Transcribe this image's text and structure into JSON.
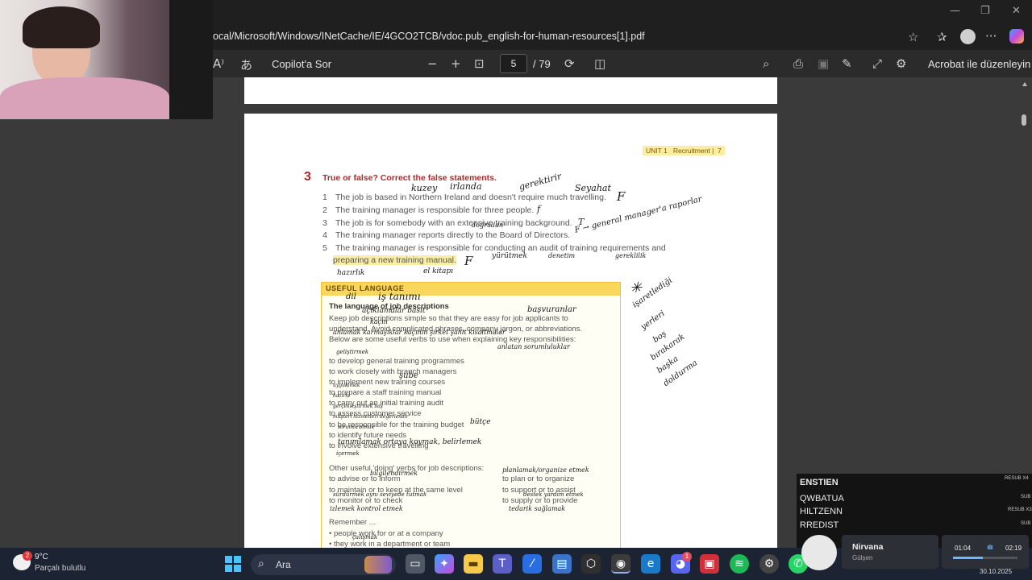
{
  "browser": {
    "address": "ocal/Microsoft/Windows/INetCache/IE/4GCO2TCB/vdoc.pub_english-for-human-resources[1].pdf",
    "window_controls": [
      "—",
      "❐",
      "✕"
    ]
  },
  "pdf_toolbar": {
    "copilot_label": "Copilot'a Sor",
    "page_current": "5",
    "page_total": "/ 79",
    "acrobat_label": "Acrobat ile düzenleyin"
  },
  "document": {
    "header_unit": "UNIT 1",
    "header_section": "Recruitment",
    "header_page": "7",
    "exercise_number": "3",
    "exercise_title": "True or false? Correct the false statements.",
    "statements": [
      {
        "num": "1",
        "text": "The job is based in Northern Ireland and doesn't require much travelling."
      },
      {
        "num": "2",
        "text": "The training manager is responsible for three people."
      },
      {
        "num": "3",
        "text": "The job is for somebody with an extensive training background."
      },
      {
        "num": "4",
        "text": "The training manager reports directly to the Board of Directors."
      },
      {
        "num": "5",
        "text": "The training manager is responsible for conducting an audit of training requirements and"
      },
      {
        "num": "",
        "text": "preparing a new training manual."
      }
    ],
    "useful_language": {
      "heading": "USEFUL LANGUAGE",
      "subheading": "The language of job descriptions",
      "intro": [
        "Keep job descriptions simple so that they are easy for job applicants to",
        "understand. Avoid complicated phrases, company jargon, or abbreviations.",
        "Below are some useful verbs to use when explaining key responsibilities:"
      ],
      "verbs": [
        "to develop general training programmes",
        "to work closely with branch managers",
        "to implement new training courses",
        "to prepare a staff training manual",
        "to carry out an initial training audit",
        "to assess customer service",
        "to be responsible for the training budget",
        "to identify future needs",
        "to involve extensive travelling"
      ],
      "other_heading": "Other useful 'doing' verbs for job descriptions:",
      "other_left": [
        "to advise or to inform",
        "to maintain or to keep at the same level",
        "to monitor or to check"
      ],
      "other_right": [
        "to plan or to organize",
        "to support or to assist",
        "to supply or to provide"
      ],
      "remember": "Remember ...",
      "bullets": [
        "people work for or at a company",
        "they work in a department or team"
      ]
    },
    "handwriting": {
      "kuzey": "kuzey",
      "irlanda": "irlanda",
      "gerektirir": "gerektirir",
      "seyahat": "Seyahat",
      "f1": "F",
      "f2": "f",
      "t3": "T",
      "t4_arrow": "F → general manager'a raporlar",
      "dogrudan": "doğrudan",
      "f5": "F",
      "yurutmek": "yürütmek",
      "denetim": "denetim",
      "gereklilik": "gereklilik",
      "hazirlik": "hazırlık",
      "el_kitabi": "el kitapı",
      "dil": "dil",
      "is_tanimi": "iş tanımı",
      "aciklamalar_basit": "açıklamalar basit",
      "basvuranlar": "başvuranlar",
      "kacin": "kaçın",
      "anlamak": "anlamak karmaşıklar kaçının şirket şahit kısaltmalar",
      "anlatan_sorumluluklar": "anlatan sorumluluklar",
      "gelistirmek": "geliştirmek",
      "sube": "şube",
      "uygulamak": "uygulamak",
      "hazirla": "hazırla",
      "gerceklestirmek": "gerçekleştirmek baş",
      "musteri": "müşteri hizmetleri değerlendir",
      "sorumlu": "sorumlu olmak",
      "butce": "bütçe",
      "tanimlamak": "tanımlamak ortaya koymak, belirlemek",
      "icermek": "içermek",
      "bilgilendirmek": "bilgilendirmek",
      "planlamak": "planlamak/organize etmek",
      "surdurmek": "sürdürmek aynı seviyede tutmak",
      "destek": "destek yardım etmek",
      "izlemek": "izlemek kontrol etmek",
      "tedarik": "tedarik sağlamak",
      "calismak": "çalışmak",
      "star": "✳",
      "side_notes": [
        "işaretlediği",
        "yerleri",
        "boş",
        "bırakarak",
        "başka",
        "doldurma"
      ]
    }
  },
  "overlay": {
    "rows": [
      {
        "name": "ENSTIEN",
        "tag": "RESUB X4"
      },
      {
        "name": "QWBATUA",
        "tag": "SUB"
      },
      {
        "name": "HILTZENN",
        "tag": "RESUB X3"
      },
      {
        "name": "RREDIST",
        "tag": "SUB"
      }
    ]
  },
  "media": {
    "title": "Nirvana",
    "artist": "Gülşen",
    "elapsed": "01:04",
    "duration": "02:19",
    "progress": 0.46
  },
  "taskbar": {
    "weather_temp": "9°C",
    "weather_desc": "Parçalı bulutlu",
    "weather_badge": "2",
    "search_label": "Ara",
    "date_partial": "30.10.2025",
    "discord_badge": "1"
  },
  "colors": {
    "accent_yellow": "#f8d75a",
    "highlight": "#fbeea0",
    "exercise_red": "#b3262b",
    "taskbar": "#1c2333"
  }
}
